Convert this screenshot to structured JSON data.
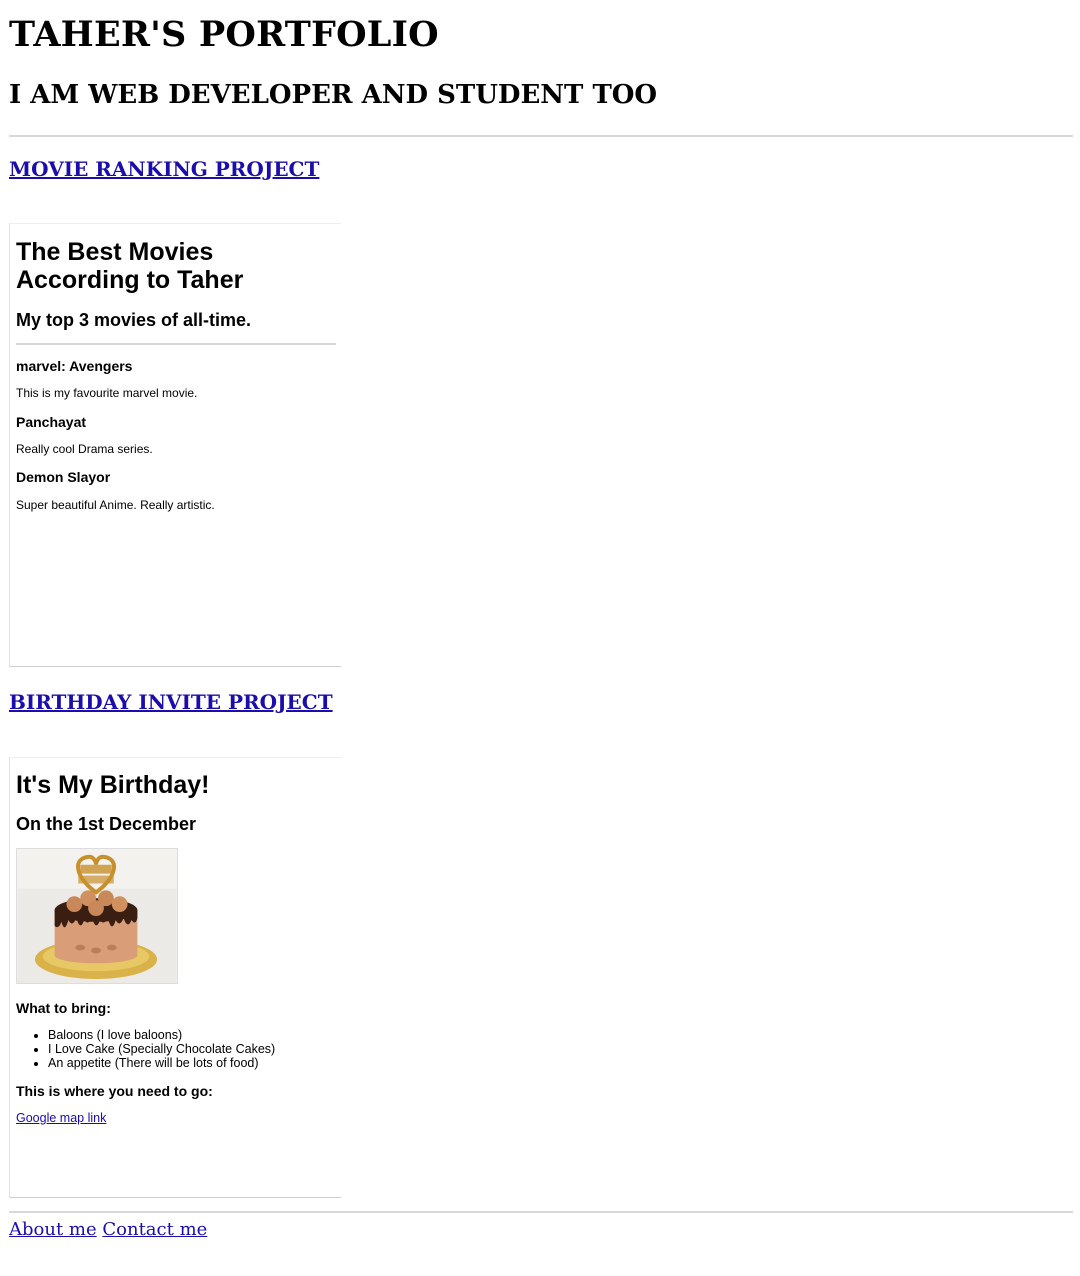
{
  "header": {
    "title": "TAHER'S PORTFOLIO",
    "subtitle": "I AM WEB DEVELOPER AND STUDENT TOO"
  },
  "projects": [
    {
      "link_label": "MOVIE RANKING PROJECT",
      "embed": {
        "title": "The Best Movies According to Taher",
        "subtitle": "My top 3 movies of all-time.",
        "movies": [
          {
            "name": "marvel: Avengers",
            "desc": "This is my favourite marvel movie."
          },
          {
            "name": "Panchayat",
            "desc": "Really cool Drama series."
          },
          {
            "name": "Demon Slayor",
            "desc": "Super beautiful Anime. Really artistic."
          }
        ]
      }
    },
    {
      "link_label": "BIRTHDAY INVITE PROJECT",
      "embed": {
        "title": "It's My Birthday!",
        "subtitle": "On the 1st December",
        "bring_heading": "What to bring:",
        "bring_items": [
          "Baloons (I love baloons)",
          "I Love Cake (Specially Chocolate Cakes)",
          "An appetite (There will be lots of food)"
        ],
        "where_heading": "This is where you need to go:",
        "map_link": "Google map link"
      }
    }
  ],
  "footer": {
    "about_label": "About me",
    "contact_label": "Contact me"
  }
}
